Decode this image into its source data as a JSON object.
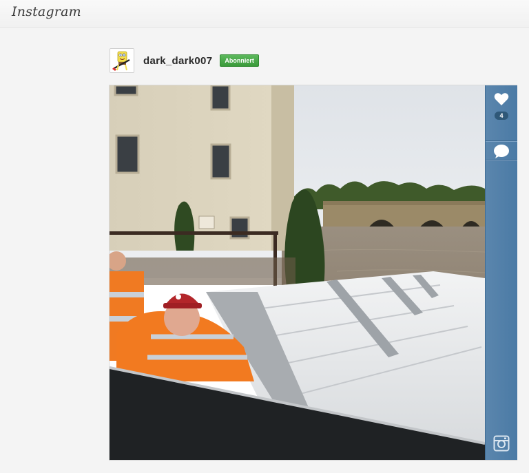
{
  "app": {
    "logo_text": "Instagram"
  },
  "post": {
    "username": "dark_dark007",
    "follow_status": "Abonniert",
    "like_count": "4"
  },
  "icons": {
    "like": "heart-icon",
    "comment": "comment-bubble-icon",
    "instagram": "instagram-camera-icon"
  },
  "colors": {
    "accent_action_bar": "#4f7ea8",
    "follow_badge": "#44a844"
  }
}
